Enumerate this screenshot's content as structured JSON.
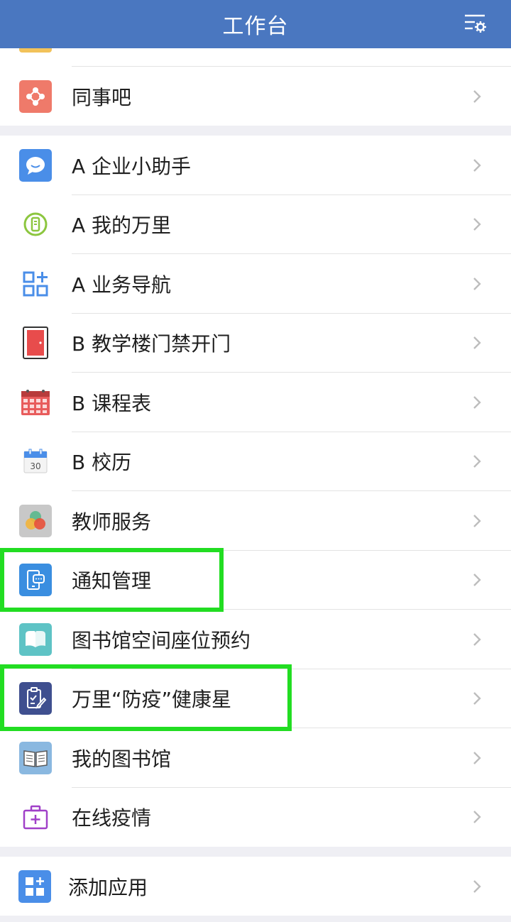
{
  "header": {
    "title": "工作台",
    "settings_icon": "list-settings-icon"
  },
  "section1": {
    "items": [
      {
        "label": "同事吧",
        "icon": "share-nodes-icon",
        "color": "#ef7a6a"
      }
    ]
  },
  "section2": {
    "items": [
      {
        "label": "A 企业小助手",
        "icon": "chat-bubble-icon",
        "color": "#4a8ee8"
      },
      {
        "label": "A 我的万里",
        "icon": "badge-icon",
        "color": "#8cc63f"
      },
      {
        "label": "A 业务导航",
        "icon": "grid-plus-icon",
        "color": "#4a8ee8"
      },
      {
        "label": "B 教学楼门禁开门",
        "icon": "door-icon",
        "color": "#e84c4c"
      },
      {
        "label": "B 课程表",
        "icon": "calendar-table-icon",
        "color": "#e84c4c"
      },
      {
        "label": "B 校历",
        "icon": "calendar-icon",
        "color": "#4a8ee8"
      },
      {
        "label": "教师服务",
        "icon": "circles-icon",
        "color": "#c8c8c8"
      },
      {
        "label": "通知管理",
        "icon": "phone-message-icon",
        "color": "#3a8ee0"
      },
      {
        "label": "图书馆空间座位预约",
        "icon": "seat-icon",
        "color": "#5ec3c5"
      },
      {
        "label": "万里“防疫”健康星",
        "icon": "clipboard-edit-icon",
        "color": "#3f4f8f"
      },
      {
        "label": "我的图书馆",
        "icon": "book-icon",
        "color": "#8ab8e0"
      },
      {
        "label": "在线疫情",
        "icon": "medical-kit-icon",
        "color": "#a040c8"
      }
    ]
  },
  "section3": {
    "items": [
      {
        "label": "添加应用",
        "icon": "add-app-icon",
        "color": "#4a8ee8"
      }
    ]
  },
  "highlight_color": "#22dd22"
}
